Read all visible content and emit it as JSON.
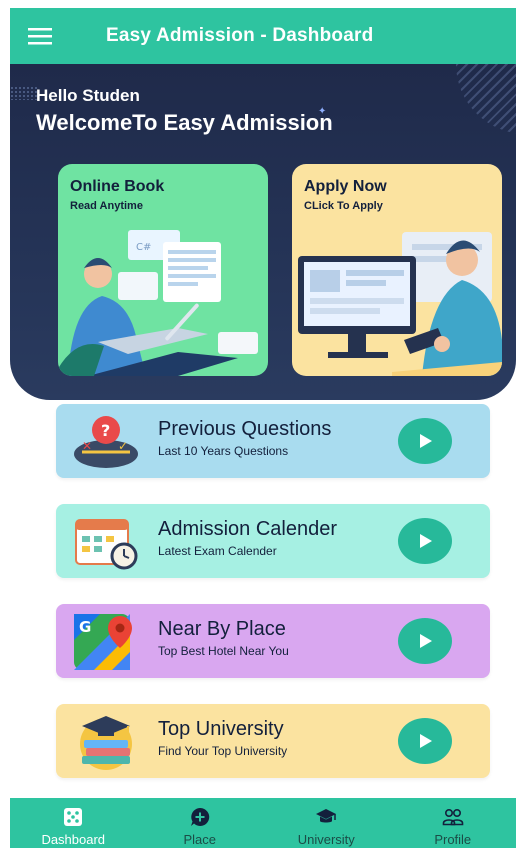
{
  "appbar": {
    "title": "Easy Admission - Dashboard",
    "menu_icon": "hamburger-menu-icon"
  },
  "hero": {
    "greeting": "Hello Studen",
    "welcome": "WelcomeTo Easy Admission",
    "cards": [
      {
        "title": "Online Book",
        "subtitle": "Read Anytime",
        "illustration": "person-laptop-illustration"
      },
      {
        "title": "Apply Now",
        "subtitle": "CLick To Apply",
        "illustration": "person-computer-illustration"
      }
    ]
  },
  "list": [
    {
      "title": "Previous Questions",
      "subtitle": "Last 10 Years Questions",
      "icon": "question-scale-icon"
    },
    {
      "title": "Admission Calender",
      "subtitle": "Latest Exam Calender",
      "icon": "calendar-clock-icon"
    },
    {
      "title": "Near By Place",
      "subtitle": "Top Best Hotel Near You",
      "icon": "google-maps-icon"
    },
    {
      "title": "Top University",
      "subtitle": "Find Your Top University",
      "icon": "graduation-books-icon"
    }
  ],
  "bottom_nav": [
    {
      "label": "Dashboard",
      "icon": "dashboard-icon",
      "active": true
    },
    {
      "label": "Place",
      "icon": "chat-plus-icon",
      "active": false
    },
    {
      "label": "University",
      "icon": "graduation-cap-icon",
      "active": false
    },
    {
      "label": "Profile",
      "icon": "people-icon",
      "active": false
    }
  ],
  "colors": {
    "primary": "#2ec4a0",
    "hero_bg": "#253457",
    "play_button": "#27b99a"
  }
}
